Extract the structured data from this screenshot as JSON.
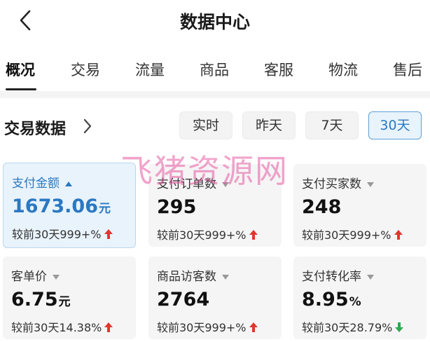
{
  "header": {
    "title": "数据中心"
  },
  "tabs": [
    {
      "label": "概况",
      "active": true
    },
    {
      "label": "交易",
      "active": false
    },
    {
      "label": "流量",
      "active": false
    },
    {
      "label": "商品",
      "active": false
    },
    {
      "label": "客服",
      "active": false
    },
    {
      "label": "物流",
      "active": false
    },
    {
      "label": "售后",
      "active": false
    }
  ],
  "section": {
    "title": "交易数据",
    "ranges": [
      {
        "label": "实时",
        "active": false
      },
      {
        "label": "昨天",
        "active": false
      },
      {
        "label": "7天",
        "active": false
      },
      {
        "label": "30天",
        "active": true
      }
    ]
  },
  "metrics": [
    {
      "label": "支付金额",
      "value": "1673.06",
      "unit": "元",
      "compare": "较前30天999+%",
      "trend": "up",
      "active": true
    },
    {
      "label": "支付订单数",
      "value": "295",
      "unit": "",
      "compare": "较前30天999+%",
      "trend": "up",
      "active": false
    },
    {
      "label": "支付买家数",
      "value": "248",
      "unit": "",
      "compare": "较前30天999+%",
      "trend": "up",
      "active": false
    },
    {
      "label": "客单价",
      "value": "6.75",
      "unit": "元",
      "compare": "较前30天14.38%",
      "trend": "up",
      "active": false
    },
    {
      "label": "商品访客数",
      "value": "2764",
      "unit": "",
      "compare": "较前30天999+%",
      "trend": "up",
      "active": false
    },
    {
      "label": "支付转化率",
      "value": "8.95",
      "unit": "%",
      "compare": "较前30天28.79%",
      "trend": "down",
      "active": false
    }
  ],
  "watermark": "飞猪资源网",
  "colors": {
    "accent": "#2a78c2",
    "up": "#e0372d",
    "down": "#2fa84f",
    "watermark": "#e65aa0"
  }
}
